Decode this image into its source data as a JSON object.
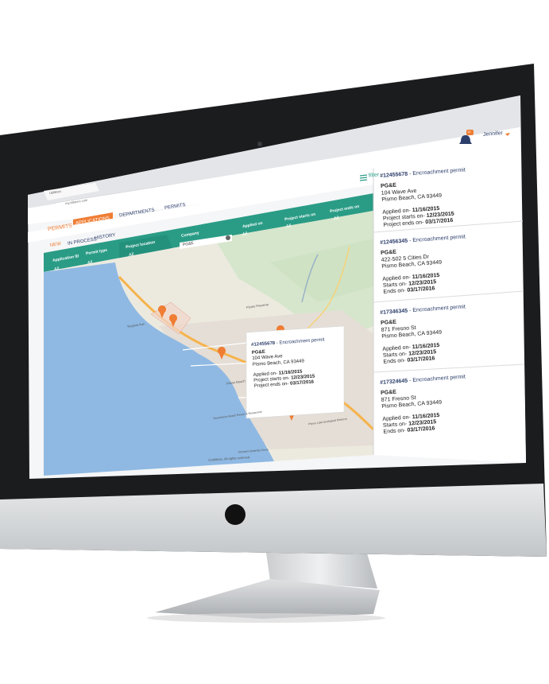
{
  "browser": {
    "tab_title": "UtilWorx",
    "address": "my.utilworx.com"
  },
  "app": {
    "logo_text": "PERMITS",
    "nav": {
      "applications": "APPLICATIONS",
      "departments": "DEPARTMENTS",
      "permits": "PERMITS"
    },
    "subtabs": {
      "new": "NEW",
      "in_process": "IN PROCESS",
      "history": "HISTORY"
    },
    "user": {
      "name": "Jennifer",
      "notification_count": "12"
    },
    "filter_label": "filter"
  },
  "filters": {
    "application_id": {
      "label": "Application ID",
      "value": "All"
    },
    "permit_type": {
      "label": "Permit type",
      "value": "All"
    },
    "project_location": {
      "label": "Project location",
      "value": "All"
    },
    "company": {
      "label": "Company",
      "value": "PG&E"
    },
    "applied_on": {
      "label": "Applied on",
      "value": "All"
    },
    "project_starts_on": {
      "label": "Project starts on",
      "value": "All"
    },
    "project_ends_on": {
      "label": "Project ends on",
      "value": "All"
    }
  },
  "map": {
    "labels": {
      "pismo_preserve": "Pismo Preserve",
      "pismo_beach": "Pismo Beach",
      "pismo_lake": "Pismo Lake Ecological Reserve",
      "spyglass": "Spyglass Park",
      "sea_venture": "SeaVenture Beach Resort & Restaurant",
      "monarch": "Monarch Butterfly Grove"
    },
    "copyright": "©UtilWorx. All rights reserved."
  },
  "popup": {
    "id": "#12455678",
    "type": " - Encroachment permit",
    "company": "PG&E",
    "address1": "104 Wave Ave",
    "address2": "Pismo Beach, CA 93449",
    "applied_label": "Applied on- ",
    "applied_date": "11/16/2015",
    "starts_label": "Project starts on- ",
    "starts_date": "12/23/2015",
    "ends_label": "Project ends on- ",
    "ends_date": "03/17/2016"
  },
  "permits": [
    {
      "id": "#12455678",
      "type": " - Encroachment permit",
      "company": "PG&E",
      "address1": "104 Wave Ave",
      "address2": "Pismo Beach, CA 93449",
      "applied_label": "Applied on- ",
      "applied_date": "11/16/2015",
      "starts_label": "Project starts on- ",
      "starts_date": "12/23/2015",
      "ends_label": "Project ends on- ",
      "ends_date": "03/17/2016"
    },
    {
      "id": "#12456345",
      "type": " - Encroachment permit",
      "company": "PG&E",
      "address1": "422-502 5 Cities Dr",
      "address2": "Pismo Beach, CA 93449",
      "applied_label": "Applied on- ",
      "applied_date": "11/16/2015",
      "starts_label": "Starts on- ",
      "starts_date": "12/23/2015",
      "ends_label": "Ends on- ",
      "ends_date": "03/17/2016"
    },
    {
      "id": "#17346345",
      "type": " - Encroachment permit",
      "company": "PG&E",
      "address1": "871 Fresno St",
      "address2": "Pismo Beach, CA 93449",
      "applied_label": "Applied on- ",
      "applied_date": "11/16/2015",
      "starts_label": "Starts on- ",
      "starts_date": "12/23/2015",
      "ends_label": "Ends on- ",
      "ends_date": "03/17/2016"
    },
    {
      "id": "#17324645",
      "type": " - Encroachment permit",
      "company": "PG&E",
      "address1": "871 Fresno St",
      "address2": "Pismo Beach, CA 93449",
      "applied_label": "Applied on- ",
      "applied_date": "11/16/2015",
      "starts_label": "Starts on- ",
      "starts_date": "12/23/2015",
      "ends_label": "Ends on- ",
      "ends_date": "03/17/2016"
    }
  ],
  "colors": {
    "teal": "#2a9c86",
    "orange": "#ef7d33",
    "navy": "#2c3e6b",
    "water": "#8fb9e3",
    "land": "#eceadf"
  }
}
